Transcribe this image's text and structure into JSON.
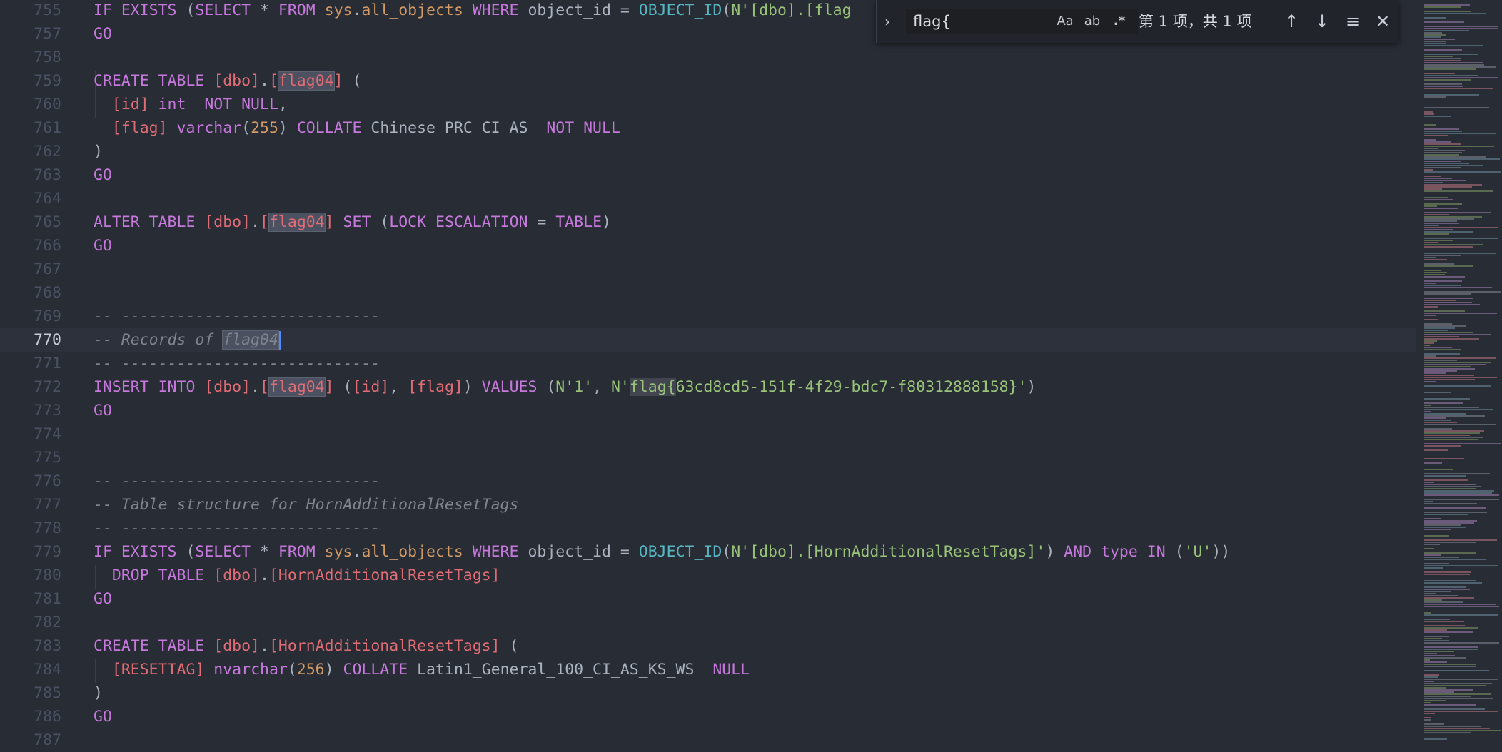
{
  "editor": {
    "current_line": "770",
    "lines": [
      {
        "n": "755",
        "t": [
          [
            "kw",
            "IF EXISTS "
          ],
          [
            "",
            "("
          ],
          [
            "kw",
            "SELECT "
          ],
          [
            "",
            "* "
          ],
          [
            "kw",
            "FROM "
          ],
          [
            "nm",
            "sys"
          ],
          [
            "",
            "."
          ],
          [
            "nm",
            "all_objects "
          ],
          [
            "kw",
            "WHERE "
          ],
          [
            "",
            "object_id = "
          ],
          [
            "fn",
            "OBJECT_ID"
          ],
          [
            "",
            "("
          ],
          [
            "st",
            "N'[dbo].[flag"
          ]
        ]
      },
      {
        "n": "757",
        "t": [
          [
            "kw",
            "GO"
          ]
        ]
      },
      {
        "n": "758",
        "t": []
      },
      {
        "n": "759",
        "t": [
          [
            "kw",
            "CREATE TABLE "
          ],
          [
            "br",
            "[dbo]"
          ],
          [
            "",
            "."
          ],
          [
            "br",
            "["
          ],
          [
            "hlbr",
            "flag04"
          ],
          [
            "br",
            "]"
          ],
          [
            "",
            " ("
          ]
        ]
      },
      {
        "n": "760",
        "t": [
          [
            "",
            "  "
          ],
          [
            "br",
            "[id]"
          ],
          [
            "kw",
            " int  NOT NULL"
          ],
          [
            "",
            ","
          ]
        ]
      },
      {
        "n": "761",
        "t": [
          [
            "",
            "  "
          ],
          [
            "br",
            "[flag]"
          ],
          [
            "kw",
            " varchar"
          ],
          [
            "",
            "("
          ],
          [
            "nm",
            "255"
          ],
          [
            "",
            ") "
          ],
          [
            "kw",
            "COLLATE "
          ],
          [
            "",
            "Chinese_PRC_CI_AS  "
          ],
          [
            "kw",
            "NOT NULL"
          ]
        ]
      },
      {
        "n": "762",
        "t": [
          [
            "",
            ")"
          ]
        ]
      },
      {
        "n": "763",
        "t": [
          [
            "kw",
            "GO"
          ]
        ]
      },
      {
        "n": "764",
        "t": []
      },
      {
        "n": "765",
        "t": [
          [
            "kw",
            "ALTER TABLE "
          ],
          [
            "br",
            "[dbo]"
          ],
          [
            "",
            "."
          ],
          [
            "br",
            "["
          ],
          [
            "hlbr",
            "flag04"
          ],
          [
            "br",
            "]"
          ],
          [
            "kw",
            " SET "
          ],
          [
            "",
            "("
          ],
          [
            "kw",
            "LOCK_ESCALATION "
          ],
          [
            "",
            "= "
          ],
          [
            "kw",
            "TABLE"
          ],
          [
            "",
            ")"
          ]
        ]
      },
      {
        "n": "766",
        "t": [
          [
            "kw",
            "GO"
          ]
        ]
      },
      {
        "n": "767",
        "t": []
      },
      {
        "n": "768",
        "t": []
      },
      {
        "n": "769",
        "t": [
          [
            "cm",
            "-- ----------------------------"
          ]
        ]
      },
      {
        "n": "770",
        "t": [
          [
            "cm",
            "-- Records of "
          ],
          [
            "hlcm",
            "flag04"
          ],
          [
            "caret",
            ""
          ]
        ]
      },
      {
        "n": "771",
        "t": [
          [
            "cm",
            "-- ----------------------------"
          ]
        ]
      },
      {
        "n": "772",
        "t": [
          [
            "kw",
            "INSERT INTO "
          ],
          [
            "br",
            "[dbo]"
          ],
          [
            "",
            "."
          ],
          [
            "br",
            "["
          ],
          [
            "hlbr",
            "flag04"
          ],
          [
            "br",
            "]"
          ],
          [
            "",
            " ("
          ],
          [
            "br",
            "[id]"
          ],
          [
            ",",
            ", "
          ],
          [
            "br",
            "[flag]"
          ],
          [
            "",
            ") "
          ],
          [
            "kw",
            "VALUES "
          ],
          [
            "",
            "("
          ],
          [
            "st",
            "N'1'"
          ],
          [
            "",
            ", "
          ],
          [
            "st",
            "N'"
          ],
          [
            "hlmain",
            "flag{"
          ],
          [
            "st",
            "63cd8cd5-151f-4f29-bdc7-f80312888158}'"
          ],
          [
            "",
            ")"
          ]
        ]
      },
      {
        "n": "773",
        "t": [
          [
            "kw",
            "GO"
          ]
        ]
      },
      {
        "n": "774",
        "t": []
      },
      {
        "n": "775",
        "t": []
      },
      {
        "n": "776",
        "t": [
          [
            "cm",
            "-- ----------------------------"
          ]
        ]
      },
      {
        "n": "777",
        "t": [
          [
            "cm",
            "-- Table structure for HornAdditionalResetTags"
          ]
        ]
      },
      {
        "n": "778",
        "t": [
          [
            "cm",
            "-- ----------------------------"
          ]
        ]
      },
      {
        "n": "779",
        "t": [
          [
            "kw",
            "IF EXISTS "
          ],
          [
            "",
            "("
          ],
          [
            "kw",
            "SELECT "
          ],
          [
            "",
            "* "
          ],
          [
            "kw",
            "FROM "
          ],
          [
            "nm",
            "sys"
          ],
          [
            "",
            "."
          ],
          [
            "nm",
            "all_objects "
          ],
          [
            "kw",
            "WHERE "
          ],
          [
            "",
            "object_id = "
          ],
          [
            "fn",
            "OBJECT_ID"
          ],
          [
            "",
            "("
          ],
          [
            "st",
            "N'[dbo].[HornAdditionalResetTags]'"
          ],
          [
            "",
            ") "
          ],
          [
            "kw",
            "AND "
          ],
          [
            "kw",
            "type "
          ],
          [
            "kw",
            "IN "
          ],
          [
            "",
            "("
          ],
          [
            "st",
            "'U'"
          ],
          [
            "",
            "))"
          ]
        ]
      },
      {
        "n": "780",
        "t": [
          [
            "",
            "  "
          ],
          [
            "kw",
            "DROP TABLE "
          ],
          [
            "br",
            "[dbo]"
          ],
          [
            "",
            "."
          ],
          [
            "br",
            "[HornAdditionalResetTags]"
          ]
        ]
      },
      {
        "n": "781",
        "t": [
          [
            "kw",
            "GO"
          ]
        ]
      },
      {
        "n": "782",
        "t": []
      },
      {
        "n": "783",
        "t": [
          [
            "kw",
            "CREATE TABLE "
          ],
          [
            "br",
            "[dbo]"
          ],
          [
            "",
            "."
          ],
          [
            "br",
            "[HornAdditionalResetTags]"
          ],
          [
            "",
            " ("
          ]
        ]
      },
      {
        "n": "784",
        "t": [
          [
            "",
            "  "
          ],
          [
            "br",
            "[RESETTAG]"
          ],
          [
            "kw",
            " nvarchar"
          ],
          [
            "",
            "("
          ],
          [
            "nm",
            "256"
          ],
          [
            "",
            ") "
          ],
          [
            "kw",
            "COLLATE "
          ],
          [
            "",
            "Latin1_General_100_CI_AS_KS_WS  "
          ],
          [
            "kw",
            "NULL"
          ]
        ]
      },
      {
        "n": "785",
        "t": [
          [
            "",
            ")"
          ]
        ]
      },
      {
        "n": "786",
        "t": [
          [
            "kw",
            "GO"
          ]
        ]
      },
      {
        "n": "787",
        "t": []
      }
    ]
  },
  "find": {
    "toggle_icon": "chevron-right-icon",
    "query": "flag{",
    "match_case_label": "Aa",
    "whole_word_label": "ab",
    "regex_label": ".*",
    "result_count": "第 1 项，共 1 项",
    "prev_icon": "arrow-up-icon",
    "next_icon": "arrow-down-icon",
    "selection_icon": "find-in-selection-icon",
    "close_icon": "close-icon"
  },
  "colors": {
    "background": "#282c34",
    "keyword": "#c678dd",
    "bracket_ident": "#e06c75",
    "function": "#56b6c2",
    "string": "#98c379",
    "comment": "#7f848e",
    "number": "#d19a66"
  }
}
